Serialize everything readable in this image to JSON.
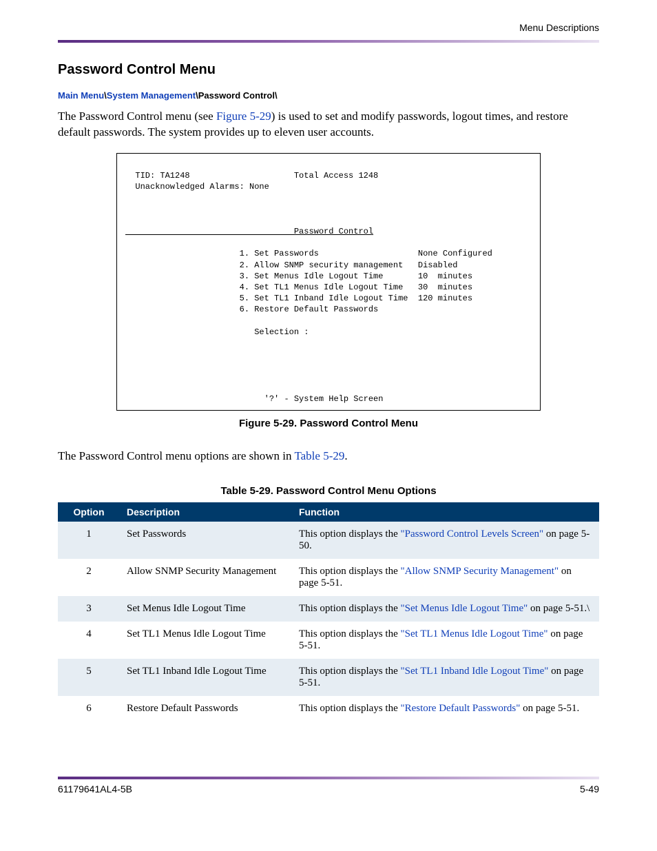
{
  "header": {
    "right": "Menu Descriptions"
  },
  "section": {
    "heading": "Password Control Menu"
  },
  "breadcrumb": {
    "main": "Main Menu",
    "sysmgmt": "System Management",
    "current": "Password Control\\"
  },
  "para1": {
    "pre": "The Password Control menu (see ",
    "link": "Figure 5-29",
    "post": ") is used to set and modify passwords, logout times, and restore default passwords. The system provides up to eleven user accounts."
  },
  "terminal": {
    "line_tid": "  TID: TA1248                     Total Access 1248",
    "line_alarms": "  Unacknowledged Alarms: None",
    "title": "                                  Password Control",
    "item1": "                       1. Set Passwords                    None Configured",
    "item2": "                       2. Allow SNMP security management   Disabled",
    "item3": "                       3. Set Menus Idle Logout Time       10  minutes",
    "item4": "                       4. Set TL1 Menus Idle Logout Time   30  minutes",
    "item5": "                       5. Set TL1 Inband Idle Logout Time  120 minutes",
    "item6": "                       6. Restore Default Passwords",
    "selection": "                          Selection :",
    "help": "                            '?' - System Help Screen"
  },
  "figure_caption": "Figure 5-29.  Password Control Menu",
  "para2": {
    "pre": "The Password Control menu options are shown in ",
    "link": "Table 5-29",
    "post": "."
  },
  "table_caption": "Table 5-29.  Password Control Menu Options",
  "table": {
    "headers": {
      "option": "Option",
      "description": "Description",
      "function": "Function"
    },
    "rows": [
      {
        "opt": "1",
        "desc": "Set Passwords",
        "fn_pre": "This option displays the ",
        "fn_link": "\"Password Control Levels Screen\"",
        "fn_post": " on page 5-50."
      },
      {
        "opt": "2",
        "desc": "Allow SNMP Security Management",
        "fn_pre": "This option displays the ",
        "fn_link": "\"Allow SNMP Security Management\"",
        "fn_post": " on page 5-51."
      },
      {
        "opt": "3",
        "desc": "Set Menus Idle Logout Time",
        "fn_pre": "This option displays the ",
        "fn_link": "\"Set Menus Idle Logout Time\"",
        "fn_post": " on page 5-51.\\"
      },
      {
        "opt": "4",
        "desc": "Set TL1 Menus Idle Logout Time",
        "fn_pre": "This option displays the ",
        "fn_link": "\"Set TL1 Menus Idle Logout Time\"",
        "fn_post": " on page 5-51."
      },
      {
        "opt": "5",
        "desc": "Set TL1 Inband Idle Logout Time",
        "fn_pre": "This option displays the ",
        "fn_link": "\"Set TL1 Inband Idle Logout Time\"",
        "fn_post": " on page 5-51."
      },
      {
        "opt": "6",
        "desc": "Restore Default Passwords",
        "fn_pre": "This option displays the ",
        "fn_link": "\"Restore Default Passwords\"",
        "fn_post": " on page 5-51."
      }
    ]
  },
  "footer": {
    "left": "61179641AL4-5B",
    "right": "5-49"
  }
}
